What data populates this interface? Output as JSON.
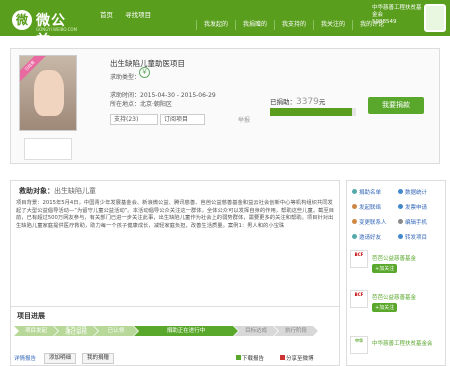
{
  "header": {
    "logo_text": "微公益",
    "logo_sub": "GONGYI.WEIBO.COM",
    "logo_mark": "微",
    "nav_home": "首页",
    "nav_find": "寻找项目",
    "user_name": "中华慈善工程扶贫基金会",
    "user_count": "5988549",
    "menu": [
      "我发起的",
      "我捐赠的",
      "我支持的",
      "我关注的",
      "我的评论"
    ]
  },
  "project": {
    "title": "出生缺陷儿童助医项目",
    "type_label": "求助类型：",
    "type_icon": "¥",
    "period_label": "求助时间：",
    "period": "2015-04-30 - 2015-06-29",
    "region_label": "所在地点：",
    "region": "北京·朝阳区",
    "support_label": "支持(23)",
    "report_label": "订阅项目",
    "flag": "举报",
    "ribbon": "已结束",
    "raised_label": "已捐助：",
    "raised_amount": "3379",
    "raised_unit": "元",
    "raised_fraction": 0.95,
    "donate_label": "我要捐款"
  },
  "detail": {
    "heading_label": "救助对象：",
    "heading_value": "出生缺陷儿童",
    "body": "项目背景：2015年5月4日，中国青少年发展基金会、新浪微公益、腾讯慈善、芭芭公益慈善基金和益云社会创新中心等机构组织共同发起了大型公益倡导活动—“为留守儿童公益活动”。本活动倡导公众关注这一群体，全体公众可以发挥自身的作用，帮助这些儿童。截至目前，已有超过500万网友参与，有关部门已进一步关注此事，出生缺陷儿童作为社会上的弱势群体，需要更多的关注和帮助。项目针对出生缺陷儿童家庭提供医疗救助，助力每一个孩子健康成长，减轻家庭负担，改善生活质量。案例1：男人和的小宝珠"
  },
  "sidebar": {
    "links": [
      "捐助名单",
      "数据统计",
      "发起联络",
      "发票申请",
      "变更联系人",
      "编辑手机",
      "邀请好友",
      "转发项目"
    ],
    "donors": [
      {
        "logo": "BCF",
        "name": "芭芭公益慈善基金",
        "follow": "+加关注"
      },
      {
        "logo": "BCF",
        "name": "芭芭公益慈善基金",
        "follow": "+加关注"
      },
      {
        "logo": "中华",
        "name": "中华慈善工程扶贫基金会",
        "follow": "+加关注"
      }
    ]
  },
  "progress": {
    "title": "项目进展",
    "steps": [
      "项目发起",
      "证实为真\n通过审核",
      "已认领",
      "捐助正在进行中",
      "目标达成",
      "执行阶段"
    ],
    "tabs": [
      "详情报告",
      "添加明细",
      "我的捐赠"
    ],
    "download": "下载报告",
    "share": "分享至微博"
  },
  "colors": {
    "brand": "#5a9e1e",
    "accent": "#59a72b",
    "link": "#3367b7"
  }
}
